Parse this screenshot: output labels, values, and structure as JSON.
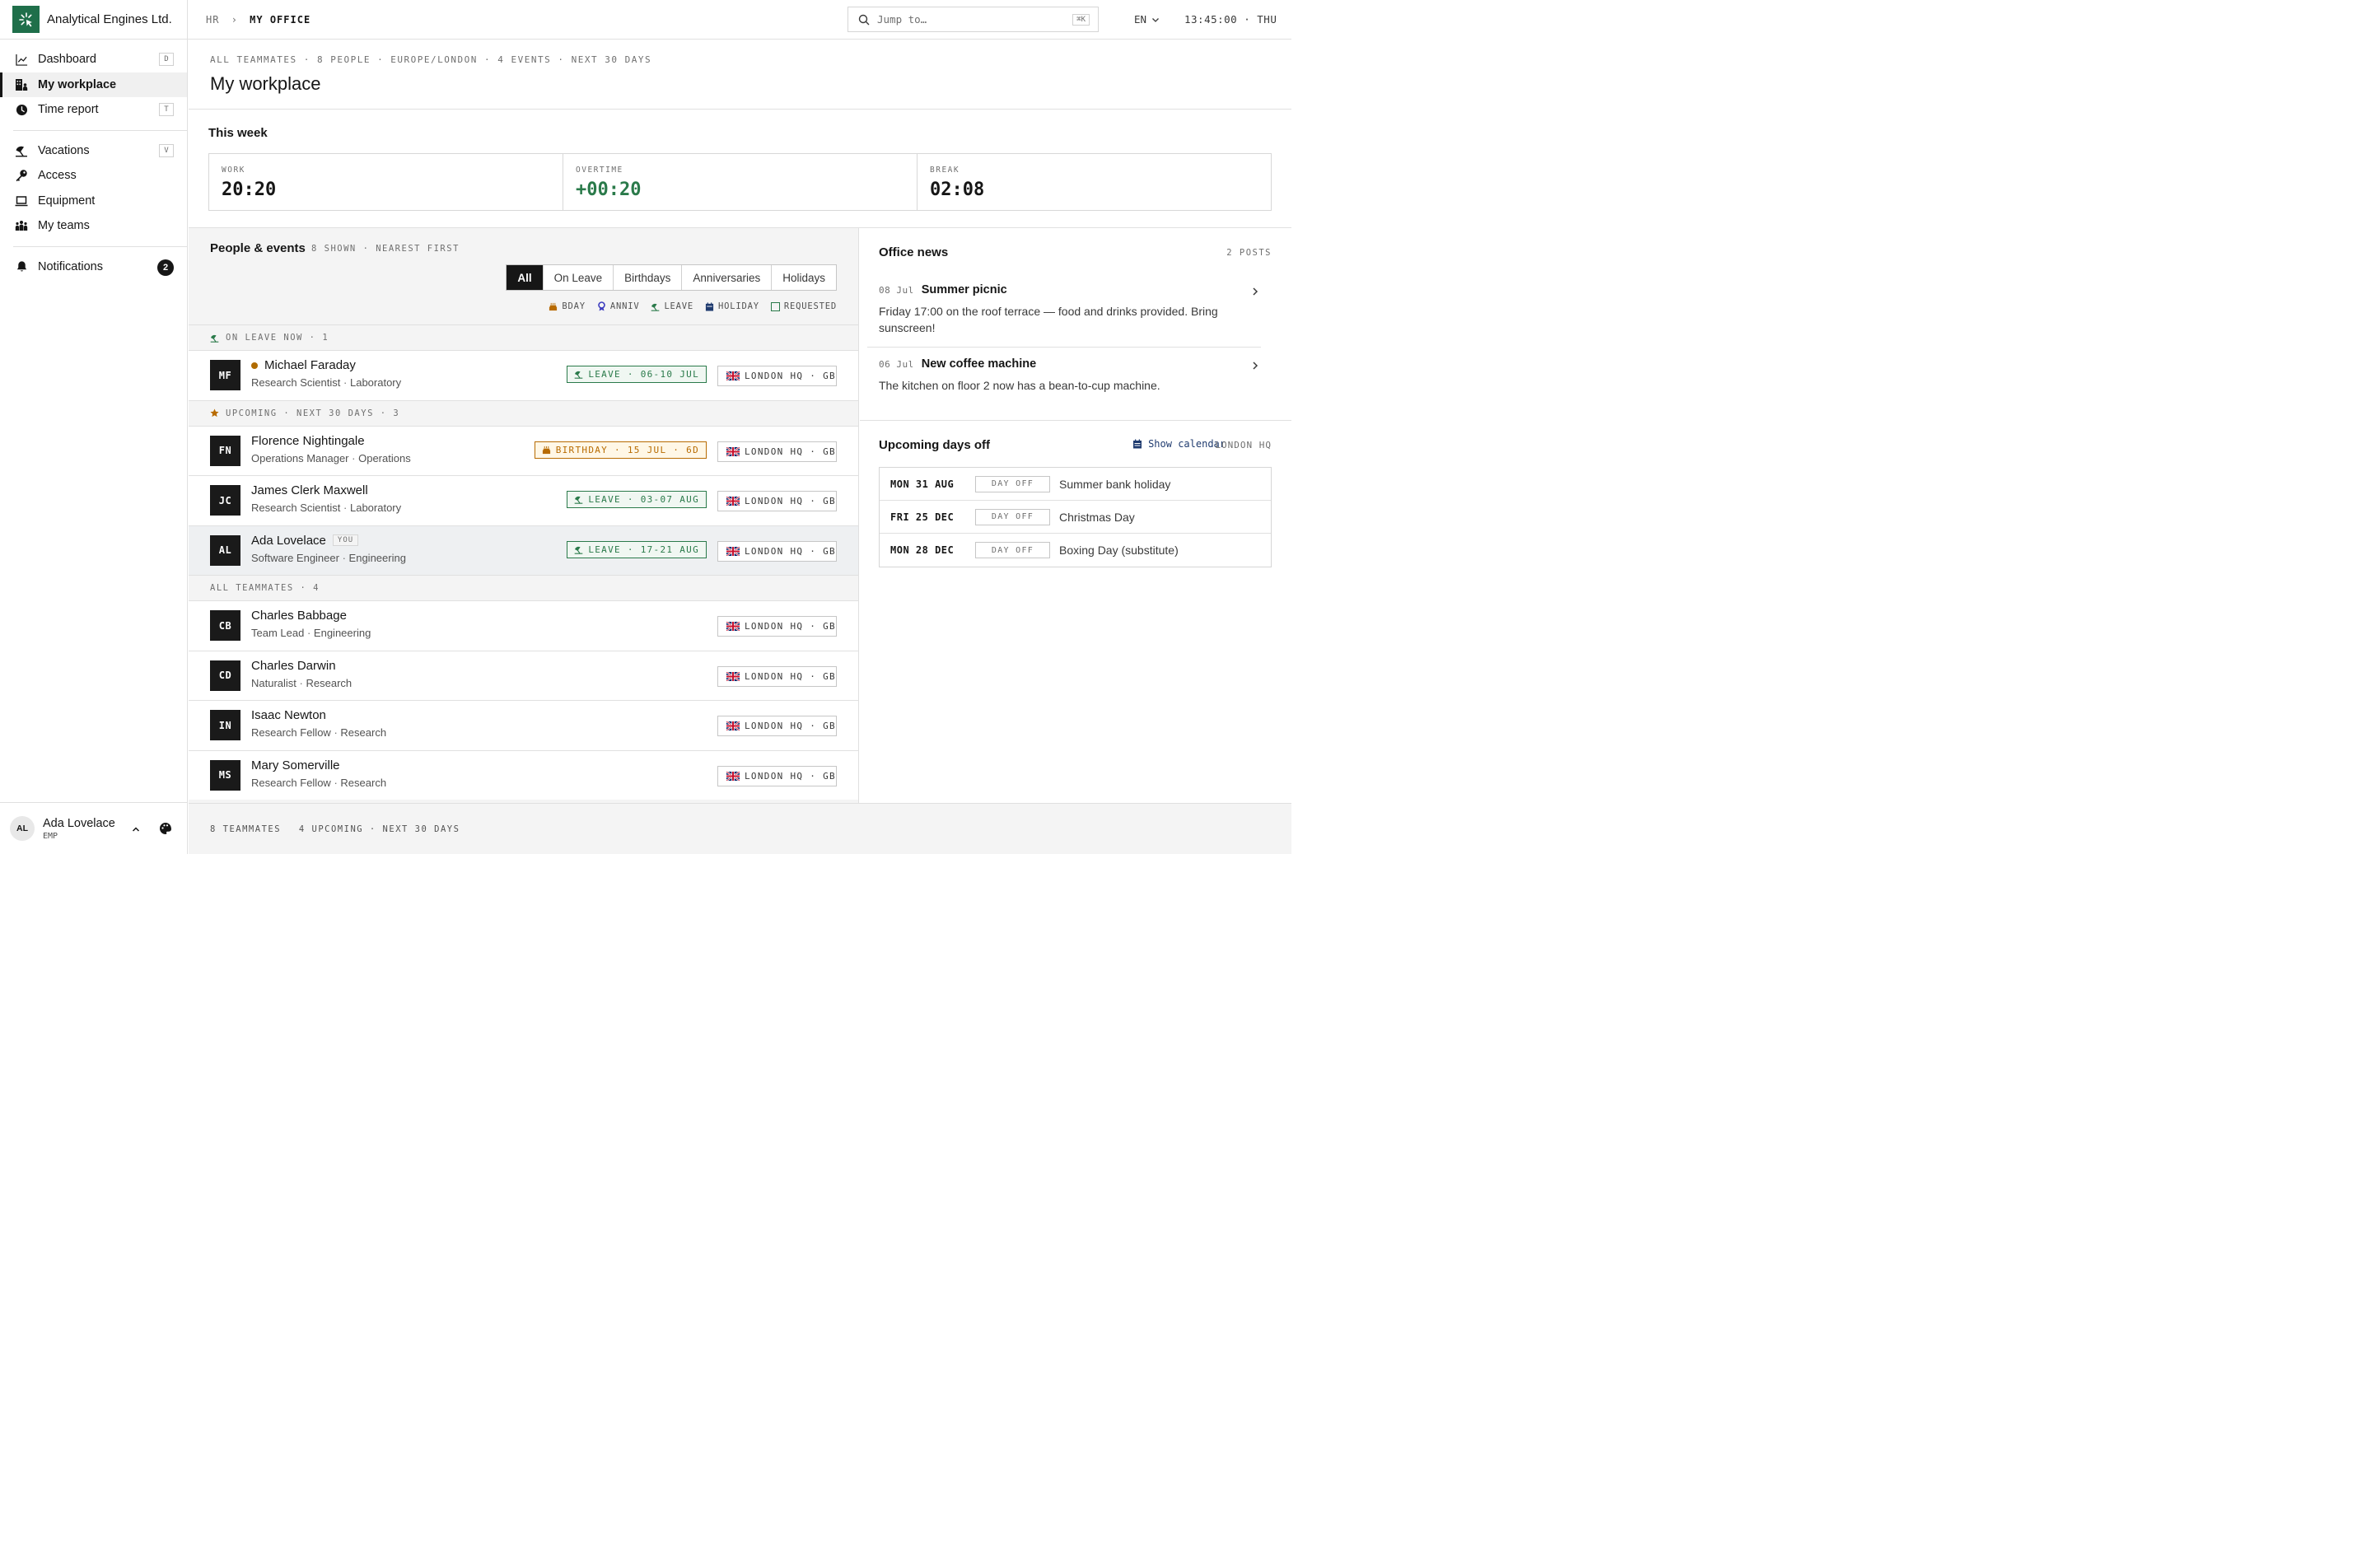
{
  "brand": {
    "name": "Analytical Engines Ltd."
  },
  "sidebar": {
    "items": [
      {
        "label": "Dashboard",
        "kbd": "D",
        "icon": "chart-line-icon"
      },
      {
        "label": "My workplace",
        "icon": "building-people-icon"
      },
      {
        "label": "Time report",
        "kbd": "T",
        "icon": "clock-icon"
      },
      {
        "label": "Vacations",
        "kbd": "V",
        "icon": "beach-umbrella-icon"
      },
      {
        "label": "Access",
        "icon": "key-icon"
      },
      {
        "label": "Equipment",
        "icon": "laptop-icon"
      },
      {
        "label": "My teams",
        "icon": "team-icon"
      },
      {
        "label": "Notifications",
        "count": "2",
        "icon": "bell-icon"
      }
    ],
    "user": {
      "initials": "AL",
      "name": "Ada Lovelace",
      "role": "EMP"
    }
  },
  "topbar": {
    "crumb_parent": "HR",
    "crumb_sep": "›",
    "crumb_current": "MY OFFICE",
    "search_placeholder": "Jump to…",
    "search_kbd": "⌘K",
    "lang": "EN",
    "clock": "13:45:00 · THU"
  },
  "header": {
    "subtitle": "ALL TEAMMATES · 8 PEOPLE · EUROPE/LONDON · 4 EVENTS · NEXT 30 DAYS",
    "title": "My workplace"
  },
  "week": {
    "title": "This week",
    "stats": [
      {
        "label": "WORK",
        "value": "20:20"
      },
      {
        "label": "OVERTIME",
        "value": "+00:20"
      },
      {
        "label": "BREAK",
        "value": "02:08"
      }
    ]
  },
  "people": {
    "title": "People & events",
    "meta": "8 SHOWN · NEAREST FIRST",
    "filters": [
      "All",
      "On Leave",
      "Birthdays",
      "Anniversaries",
      "Holidays"
    ],
    "legend": [
      "BDAY",
      "ANNIV",
      "LEAVE",
      "HOLIDAY",
      "REQUESTED"
    ],
    "sections": {
      "leave": "ON LEAVE NOW · 1",
      "upcoming": "UPCOMING · NEXT 30 DAYS · 3",
      "all": "ALL TEAMMATES · 4"
    },
    "location": "LONDON HQ · GB",
    "you_label": "YOU",
    "rows": [
      {
        "initials": "MF",
        "name": "Michael Faraday",
        "title": "Research Scientist",
        "dept": "Laboratory",
        "tag": "LEAVE · 06-10 JUL"
      },
      {
        "initials": "FN",
        "name": "Florence Nightingale",
        "title": "Operations Manager",
        "dept": "Operations",
        "tag": "BIRTHDAY · 15 JUL · 6D"
      },
      {
        "initials": "JC",
        "name": "James Clerk Maxwell",
        "title": "Research Scientist",
        "dept": "Laboratory",
        "tag": "LEAVE · 03-07 AUG"
      },
      {
        "initials": "AL",
        "name": "Ada Lovelace",
        "title": "Software Engineer",
        "dept": "Engineering",
        "tag": "LEAVE · 17-21 AUG"
      },
      {
        "initials": "CB",
        "name": "Charles Babbage",
        "title": "Team Lead",
        "dept": "Engineering"
      },
      {
        "initials": "CD",
        "name": "Charles Darwin",
        "title": "Naturalist",
        "dept": "Research"
      },
      {
        "initials": "IN",
        "name": "Isaac Newton",
        "title": "Research Fellow",
        "dept": "Research"
      },
      {
        "initials": "MS",
        "name": "Mary Somerville",
        "title": "Research Fellow",
        "dept": "Research"
      }
    ]
  },
  "footer": {
    "teammates": "8 TEAMMATES",
    "upcoming": "4 UPCOMING · NEXT 30 DAYS"
  },
  "news": {
    "title": "Office news",
    "meta": "2 POSTS",
    "posts": [
      {
        "date": "08 Jul",
        "title": "Summer picnic",
        "body": "Friday 17:00 on the roof terrace — food and drinks provided. Bring sunscreen!"
      },
      {
        "date": "06 Jul",
        "title": "New coffee machine",
        "body": "The kitchen on floor 2 now has a bean-to-cup machine."
      }
    ]
  },
  "days_off": {
    "title": "Upcoming days off",
    "calendar_btn": "Show calendar",
    "location": "LONDON HQ",
    "rows": [
      {
        "date": "MON 31 AUG",
        "badge": "DAY OFF",
        "name": "Summer bank holiday"
      },
      {
        "date": "FRI 25 DEC",
        "badge": "DAY OFF",
        "name": "Christmas Day"
      },
      {
        "date": "MON 28 DEC",
        "badge": "DAY OFF",
        "name": "Boxing Day (substitute)"
      }
    ]
  },
  "colors": {
    "brand": "#1f6f4a",
    "leave": "#2a7a4a",
    "birthday": "#b86b00",
    "calendar": "#1f3b6f"
  }
}
